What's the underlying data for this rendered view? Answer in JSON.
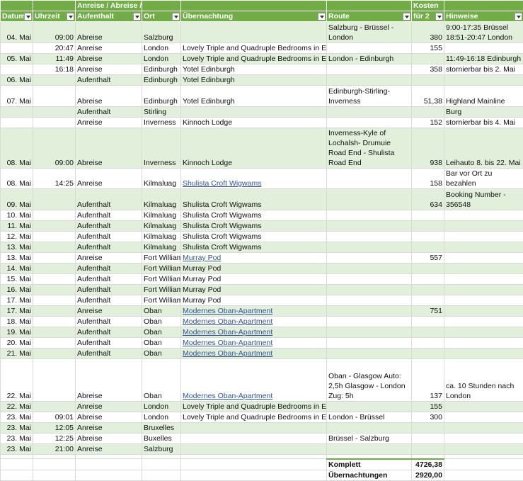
{
  "headers": {
    "datum": "Datum",
    "uhrzeit": "Uhrzeit",
    "anreise_top": "Anreise / Abreise /",
    "anreise_bottom": "Aufenthalt",
    "ort": "Ort",
    "uebernachtung": "Übernachtung",
    "route": "Route",
    "kosten_top": "Kosten",
    "kosten_bottom": "für 2",
    "hinweise": "Hinweise"
  },
  "rows": [
    {
      "band": "g",
      "h": 30,
      "datum": "04. Mai",
      "uhrzeit": "09:00",
      "typ": "Abreise",
      "ort": "Salzburg",
      "uebernachtung": "",
      "link": false,
      "route": "Salzburg - Brüssel - London",
      "kosten": "380",
      "hinweise": "9:00-17:35 Brüssel 18:51-20:47 London"
    },
    {
      "band": "w",
      "h": 15,
      "datum": "",
      "uhrzeit": "20:47",
      "typ": "Anreise",
      "ort": "London",
      "uebernachtung": "Lovely Triple and Quadruple Bedrooms in Euston",
      "link": false,
      "route": "",
      "kosten": "155",
      "hinweise": ""
    },
    {
      "band": "g",
      "h": 15,
      "datum": "05. Mai",
      "uhrzeit": "11:49",
      "typ": "Abreise",
      "ort": "London",
      "uebernachtung": "Lovely Triple and Quadruple Bedrooms in Euston",
      "link": false,
      "route": "London - Edinburgh",
      "kosten": "",
      "hinweise": "11:49-16:18 Edinburgh"
    },
    {
      "band": "w",
      "h": 15,
      "datum": "",
      "uhrzeit": "16:18",
      "typ": "Anreise",
      "ort": "Edinburgh",
      "uebernachtung": "Yotel Edinburgh",
      "link": false,
      "route": "",
      "kosten": "358",
      "hinweise": "stornierbar bis 2. Mai"
    },
    {
      "band": "g",
      "h": 15,
      "datum": "06. Mai",
      "uhrzeit": "",
      "typ": "Aufenthalt",
      "ort": "Edinburgh",
      "uebernachtung": "Yotel Edinburgh",
      "link": false,
      "route": "",
      "kosten": "",
      "hinweise": ""
    },
    {
      "band": "w",
      "h": 30,
      "datum": "07. Mai",
      "uhrzeit": "",
      "typ": "Abreise",
      "ort": "Edinburgh",
      "uebernachtung": "Yotel Edinburgh",
      "link": false,
      "route": "Edinburgh-Stirling-Inverness",
      "kosten": "51,38",
      "hinweise": "Highland Mainline"
    },
    {
      "band": "g",
      "h": 15,
      "datum": "",
      "uhrzeit": "",
      "typ": "Aufenthalt",
      "ort": "Stirling",
      "uebernachtung": "",
      "link": false,
      "route": "",
      "kosten": "",
      "hinweise": "Burg"
    },
    {
      "band": "w",
      "h": 15,
      "datum": "",
      "uhrzeit": "",
      "typ": "Anreise",
      "ort": "Inverness",
      "uebernachtung": "Kinnoch Lodge",
      "link": false,
      "route": "",
      "kosten": "152",
      "hinweise": "stornierbar bis 4. Mai"
    },
    {
      "band": "g",
      "h": 44,
      "datum": "08. Mai",
      "uhrzeit": "09:00",
      "typ": "Abreise",
      "ort": "Inverness",
      "uebernachtung": "Kinnoch Lodge",
      "link": false,
      "route": "Inverness-Kyle of Lochalsh- Drumuie Road End - Shulista Road End",
      "kosten": "938",
      "hinweise": "Leihauto 8. bis 22. Mai"
    },
    {
      "band": "w",
      "h": 15,
      "datum": "08. Mai",
      "uhrzeit": "14:25",
      "typ": "Anreise",
      "ort": "Kilmaluag",
      "uebernachtung": "Shulista Croft Wigwams",
      "link": true,
      "route": "",
      "kosten": "158",
      "hinweise": "Bar vor Ort zu bezahlen"
    },
    {
      "band": "g",
      "h": 30,
      "datum": "09. Mai",
      "uhrzeit": "",
      "typ": "Aufenthalt",
      "ort": "Kilmaluag",
      "uebernachtung": "Shulista Croft Wigwams",
      "link": false,
      "route": "",
      "kosten": "634",
      "hinweise": "Booking Number - 356548"
    },
    {
      "band": "w",
      "h": 15,
      "datum": "10. Mai",
      "uhrzeit": "",
      "typ": "Aufenthalt",
      "ort": "Kilmaluag",
      "uebernachtung": "Shulista Croft Wigwams",
      "link": false,
      "route": "",
      "kosten": "",
      "hinweise": ""
    },
    {
      "band": "g",
      "h": 15,
      "datum": "11. Mai",
      "uhrzeit": "",
      "typ": "Aufenthalt",
      "ort": "Kilmaluag",
      "uebernachtung": "Shulista Croft Wigwams",
      "link": false,
      "route": "",
      "kosten": "",
      "hinweise": ""
    },
    {
      "band": "w",
      "h": 15,
      "datum": "12. Mai",
      "uhrzeit": "",
      "typ": "Aufenthalt",
      "ort": "Kilmaluag",
      "uebernachtung": "Shulista Croft Wigwams",
      "link": false,
      "route": "",
      "kosten": "",
      "hinweise": ""
    },
    {
      "band": "g",
      "h": 15,
      "datum": "13. Mai",
      "uhrzeit": "",
      "typ": "Aufenthalt",
      "ort": "Kilmaluag",
      "uebernachtung": "Shulista Croft Wigwams",
      "link": false,
      "route": "",
      "kosten": "",
      "hinweise": ""
    },
    {
      "band": "w",
      "h": 15,
      "datum": "13. Mai",
      "uhrzeit": "",
      "typ": "Anreise",
      "ort": "Fort William",
      "uebernachtung": "Murray Pod",
      "link": true,
      "route": "",
      "kosten": "557",
      "hinweise": ""
    },
    {
      "band": "g",
      "h": 15,
      "datum": "14. Mai",
      "uhrzeit": "",
      "typ": "Aufenthalt",
      "ort": "Fort William",
      "uebernachtung": "Murray Pod",
      "link": false,
      "route": "",
      "kosten": "",
      "hinweise": ""
    },
    {
      "band": "w",
      "h": 15,
      "datum": "15. Mai",
      "uhrzeit": "",
      "typ": "Aufenthalt",
      "ort": "Fort William",
      "uebernachtung": "Murray Pod",
      "link": false,
      "route": "",
      "kosten": "",
      "hinweise": ""
    },
    {
      "band": "g",
      "h": 15,
      "datum": "16. Mai",
      "uhrzeit": "",
      "typ": "Aufenthalt",
      "ort": "Fort William",
      "uebernachtung": "Murray Pod",
      "link": false,
      "route": "",
      "kosten": "",
      "hinweise": ""
    },
    {
      "band": "w",
      "h": 15,
      "datum": "17. Mai",
      "uhrzeit": "",
      "typ": "Aufenthalt",
      "ort": "Fort William",
      "uebernachtung": "Murray Pod",
      "link": false,
      "route": "",
      "kosten": "",
      "hinweise": ""
    },
    {
      "band": "g",
      "h": 15,
      "datum": "17. Mai",
      "uhrzeit": "",
      "typ": "Anreise",
      "ort": "Oban",
      "uebernachtung": "Modernes Oban-Apartment",
      "link": true,
      "route": "",
      "kosten": "751",
      "hinweise": ""
    },
    {
      "band": "w",
      "h": 15,
      "datum": "18. Mai",
      "uhrzeit": "",
      "typ": "Aufenthalt",
      "ort": "Oban",
      "uebernachtung": "Modernes Oban-Apartment",
      "link": true,
      "route": "",
      "kosten": "",
      "hinweise": ""
    },
    {
      "band": "g",
      "h": 15,
      "datum": "19. Mai",
      "uhrzeit": "",
      "typ": "Aufenthalt",
      "ort": "Oban",
      "uebernachtung": "Modernes Oban-Apartment",
      "link": true,
      "route": "",
      "kosten": "",
      "hinweise": ""
    },
    {
      "band": "w",
      "h": 15,
      "datum": "20. Mai",
      "uhrzeit": "",
      "typ": "Aufenthalt",
      "ort": "Oban",
      "uebernachtung": "Modernes Oban-Apartment",
      "link": true,
      "route": "",
      "kosten": "",
      "hinweise": ""
    },
    {
      "band": "g",
      "h": 15,
      "datum": "21. Mai",
      "uhrzeit": "",
      "typ": "Aufenthalt",
      "ort": "Oban",
      "uebernachtung": "Modernes Oban-Apartment",
      "link": true,
      "route": "",
      "kosten": "",
      "hinweise": ""
    },
    {
      "band": "w",
      "h": 60,
      "datum": "22. Mai",
      "uhrzeit": "",
      "typ": "Abreise",
      "ort": "Oban",
      "uebernachtung": "Modernes Oban-Apartment",
      "link": true,
      "route": "Oban - Glasgow Auto: 2,5h Glasgow - London Zug: 5h",
      "kosten": "137",
      "hinweise": "ca. 10 Stunden nach London"
    },
    {
      "band": "g",
      "h": 15,
      "datum": "22. Mai",
      "uhrzeit": "",
      "typ": "Anreise",
      "ort": "London",
      "uebernachtung": "Lovely Triple and Quadruple Bedrooms in Euston",
      "link": false,
      "route": "",
      "kosten": "155",
      "hinweise": ""
    },
    {
      "band": "w",
      "h": 15,
      "datum": "23. Mai",
      "uhrzeit": "09:01",
      "typ": "Abreise",
      "ort": "London",
      "uebernachtung": "Lovely Triple and Quadruple Bedrooms in Euston",
      "link": false,
      "route": "London - Brüssel",
      "kosten": "300",
      "hinweise": ""
    },
    {
      "band": "g",
      "h": 15,
      "datum": "23. Mai",
      "uhrzeit": "12:05",
      "typ": "Anreise",
      "ort": "Bruxelles",
      "uebernachtung": "",
      "link": false,
      "route": "",
      "kosten": "",
      "hinweise": ""
    },
    {
      "band": "w",
      "h": 15,
      "datum": "23. Mai",
      "uhrzeit": "12:25",
      "typ": "Abreise",
      "ort": "Buxelles",
      "uebernachtung": "",
      "link": false,
      "route": "Brüssel - Salzburg",
      "kosten": "",
      "hinweise": ""
    },
    {
      "band": "g",
      "h": 15,
      "datum": "23. Mai",
      "uhrzeit": "21:00",
      "typ": "Anreise",
      "ort": "Salzburg",
      "uebernachtung": "",
      "link": false,
      "route": "",
      "kosten": "",
      "hinweise": ""
    }
  ],
  "totals": [
    {
      "label": "Komplett",
      "value": "4726,38"
    },
    {
      "label": "Übernachtungen",
      "value": "2920,00"
    }
  ]
}
